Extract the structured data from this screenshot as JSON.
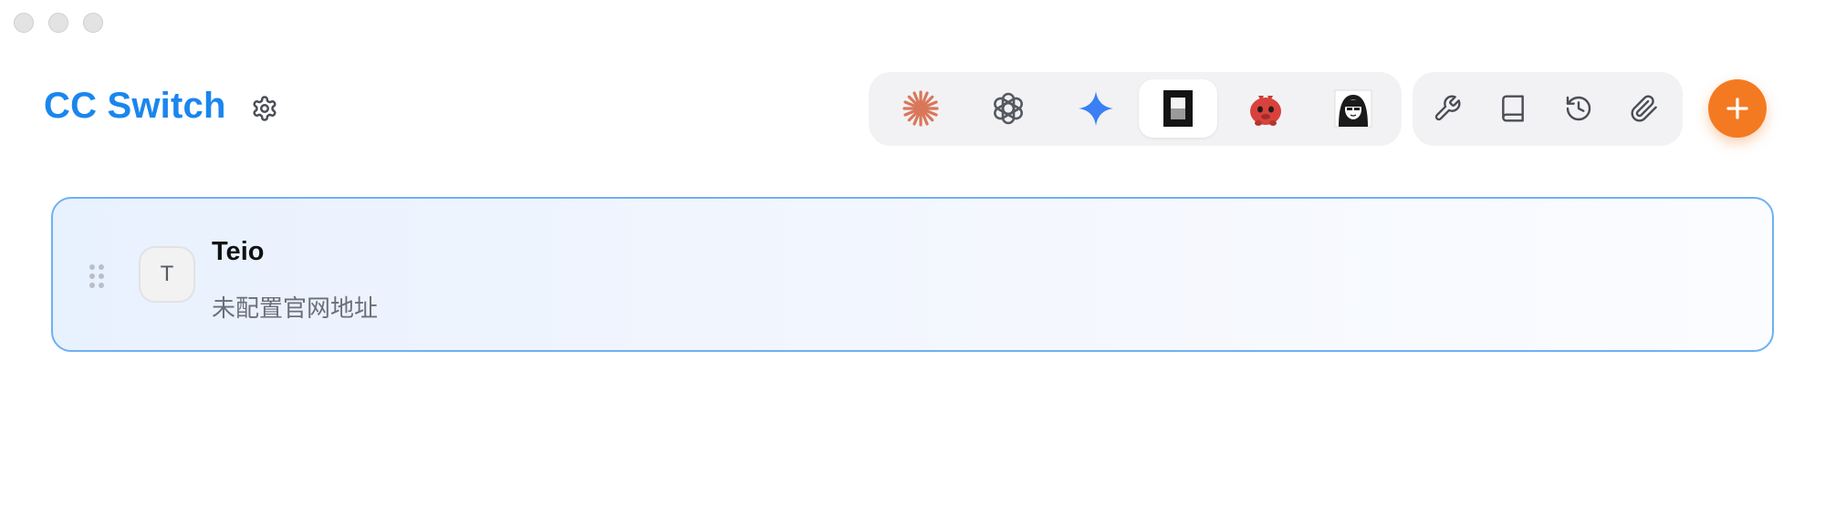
{
  "window": {
    "traffic_lights": [
      "close",
      "minimize",
      "maximize"
    ]
  },
  "header": {
    "title": "CC Switch",
    "settings_icon": "gear-icon"
  },
  "app_switcher": {
    "items": [
      {
        "name": "claude",
        "icon": "claude-asterisk-icon",
        "active": false
      },
      {
        "name": "openai",
        "icon": "openai-knot-icon",
        "active": false
      },
      {
        "name": "gemini",
        "icon": "gemini-sparkle-icon",
        "active": false
      },
      {
        "name": "bracket",
        "icon": "black-block-icon",
        "active": true
      },
      {
        "name": "red-creature",
        "icon": "red-creature-icon",
        "active": false
      },
      {
        "name": "portrait",
        "icon": "anime-portrait-icon",
        "active": false
      }
    ]
  },
  "tools": {
    "items": [
      {
        "name": "wrench",
        "icon": "wrench-icon"
      },
      {
        "name": "book",
        "icon": "book-icon"
      },
      {
        "name": "history",
        "icon": "history-icon"
      },
      {
        "name": "paperclip",
        "icon": "paperclip-icon"
      }
    ]
  },
  "add_button": {
    "icon": "plus-icon"
  },
  "colors": {
    "accent": "#1a86ee",
    "add_button": "#f47a22",
    "card_border": "#6fb0f2",
    "claude": "#d9775a",
    "gemini": "#3a7ff3"
  },
  "providers": [
    {
      "avatar_letter": "T",
      "name": "Teio",
      "subtitle": "未配置官网地址"
    }
  ]
}
